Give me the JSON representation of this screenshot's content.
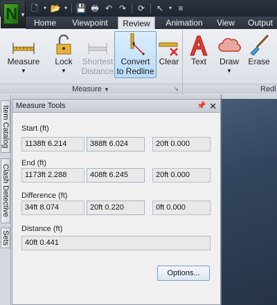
{
  "qat": {
    "icons": [
      "new-file-icon",
      "open-folder-icon",
      "save-icon",
      "print-icon",
      "undo-icon",
      "redo-icon",
      "refresh-icon",
      "select-icon",
      "customize-icon"
    ]
  },
  "tabs": [
    {
      "label": "Home"
    },
    {
      "label": "Viewpoint"
    },
    {
      "label": "Review"
    },
    {
      "label": "Animation"
    },
    {
      "label": "View"
    },
    {
      "label": "Output"
    }
  ],
  "active_tab": "Review",
  "ribbon": {
    "measure": {
      "label": "Measure",
      "caret": "▼"
    },
    "lock": {
      "label": "Lock",
      "caret": "▼"
    },
    "shortest_distance": {
      "line1": "Shortest",
      "line2": "Distance"
    },
    "convert_to_redline": {
      "line1": "Convert",
      "line2": "to Redline"
    },
    "clear": {
      "label": "Clear"
    },
    "text": {
      "label": "Text"
    },
    "draw": {
      "label": "Draw",
      "caret": "▼"
    },
    "erase": {
      "label": "Erase"
    },
    "group_measure": "Measure",
    "group_measure_caret": "▼",
    "group_redline": "Redl"
  },
  "side_tabs": [
    "Item Catalog",
    "Clash Detective",
    "Sets"
  ],
  "panel": {
    "title": "Measure Tools",
    "start": {
      "label": "Start (ft)",
      "x": "1138ft 6.214",
      "y": "388ft 6.024",
      "z": "20ft 0.000"
    },
    "end": {
      "label": "End (ft)",
      "x": "1173ft 2.288",
      "y": "408ft 6.245",
      "z": "20ft 0.000"
    },
    "difference": {
      "label": "Difference (ft)",
      "x": "34ft 8.074",
      "y": "20ft 0.220",
      "z": "0ft 0.000"
    },
    "distance": {
      "label": "Distance (ft)",
      "value": "40ft 0.441"
    },
    "options_label": "Options..."
  },
  "colors": {
    "accent": "#b9dbf6",
    "viewport": "#33455e",
    "titlebar": "#1f252e"
  }
}
